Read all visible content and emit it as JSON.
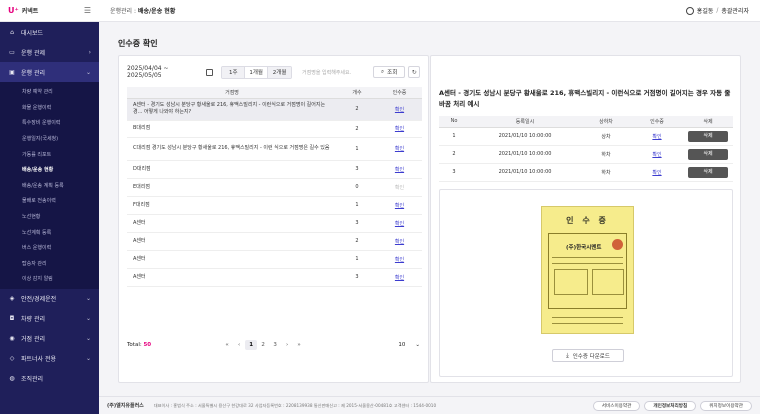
{
  "brand": {
    "logo": "U⁺",
    "name": "커넥트"
  },
  "sidebar": {
    "items": [
      {
        "label": "대시보드",
        "icon": "home-icon"
      },
      {
        "label": "운행 관제",
        "icon": "monitor-icon",
        "chev": "›"
      },
      {
        "label": "운행 관리",
        "icon": "truck-icon",
        "chev": "⌄",
        "active": true
      }
    ],
    "sub_items": [
      "차량 예약 관리",
      "화물 운행이력",
      "특수장비 운행이력",
      "운행일지(국세청)",
      "가동률 리포트",
      "배송/운송 현황",
      "배송/운송 계획 등록",
      "물배로 전송이력",
      "노선현황",
      "노선계획 등록",
      "버스 운행이력",
      "탑승자 관리",
      "이상 감지 알림"
    ],
    "bottom_items": [
      {
        "label": "안전/경제운전",
        "icon": "shield-icon"
      },
      {
        "label": "차량 관리",
        "icon": "car-icon"
      },
      {
        "label": "거점 관리",
        "icon": "pin-icon"
      },
      {
        "label": "파트너사 전용",
        "icon": "handshake-icon"
      },
      {
        "label": "조직관리",
        "icon": "people-icon"
      }
    ]
  },
  "header": {
    "crumb_prefix": "운행관리 :",
    "crumb_current": "배송/운송 현황",
    "user_name": "홍길동",
    "user_sep": "/",
    "user_role": "총괄관리자"
  },
  "page_title": "인수증 확인",
  "filter": {
    "date_range": "2025/04/04 ~ 2025/05/05",
    "periods": [
      "1주",
      "1개월",
      "2개월"
    ],
    "search_placeholder": "거점명을 입력해주세요.",
    "search_button": "조회",
    "refresh_icon": "↻"
  },
  "left_table": {
    "headers": [
      "거점명",
      "개수",
      "인수증"
    ],
    "rows": [
      {
        "name": "A센터 - 경기도 성남시 분당구 황새울로 216, 휴맥스빌리지 - 이런식으로 거점명이 길어지는 경... 어떻게 나와야 하는지?",
        "count": "2",
        "ack": "확인",
        "hl": true
      },
      {
        "name": "B대리점",
        "count": "2",
        "ack": "확인"
      },
      {
        "name": "C대리점 경기도 성남시 분당구 황새울로 216, 휴맥스빌리지 - 이런 식으로 거점명은 길수 있음",
        "count": "1",
        "ack": "확인"
      },
      {
        "name": "D대리점",
        "count": "3",
        "ack": "확인"
      },
      {
        "name": "E대리점",
        "count": "0",
        "ack": "확인",
        "disabled": true
      },
      {
        "name": "F대리점",
        "count": "1",
        "ack": "확인"
      },
      {
        "name": "A센터",
        "count": "3",
        "ack": "확인"
      },
      {
        "name": "A센터",
        "count": "2",
        "ack": "확인"
      },
      {
        "name": "A센터",
        "count": "1",
        "ack": "확인"
      },
      {
        "name": "A센터",
        "count": "3",
        "ack": "확인"
      }
    ]
  },
  "pagination": {
    "total_label": "Total:",
    "total": "50",
    "first": "«",
    "prev": "‹",
    "pages": [
      "1",
      "2",
      "3"
    ],
    "next": "›",
    "last": "»",
    "page_size": "10",
    "page_size_chev": "⌄"
  },
  "right": {
    "title": "A센터 - 경기도 성남시 분당구 황새울로 216, 휴맥스빌리지 - 이런식으로 거점명이 길어지는 경우 자동 줄바꿈 처리 예시",
    "headers": [
      "No",
      "등록일시",
      "상하차",
      "인수증",
      "삭제"
    ],
    "rows": [
      {
        "no": "1",
        "date": "2021/01/10 10:00:00",
        "type": "상차",
        "ack": "확인",
        "del": "삭제"
      },
      {
        "no": "2",
        "date": "2021/01/10 10:00:00",
        "type": "하차",
        "ack": "확인",
        "del": "삭제"
      },
      {
        "no": "3",
        "date": "2021/01/10 10:00:00",
        "type": "하차",
        "ack": "확인",
        "del": "삭제"
      }
    ],
    "receipt_title": "인 수 증",
    "receipt_company": "(주)한국시멘트",
    "download_label": "인수증 다운로드"
  },
  "footer": {
    "corp": "(주)엘지유플러스",
    "info": "대표이사 : 홍범식   주소 : 서울특별시 용산구 한강대로 32   사업자등록번호 : 2208139938   통신판매신고 : 제 2015-서울용산-00481호   고객센터 : 1544-0010",
    "buttons": [
      "서비스이용약관",
      "개인정보처리방침",
      "위치정보이용약관"
    ]
  },
  "colors": {
    "sidebar_bg": "#1f1f5a",
    "accent": "#e6007e",
    "link": "#3c3ccf",
    "delete_btn": "#555555"
  }
}
